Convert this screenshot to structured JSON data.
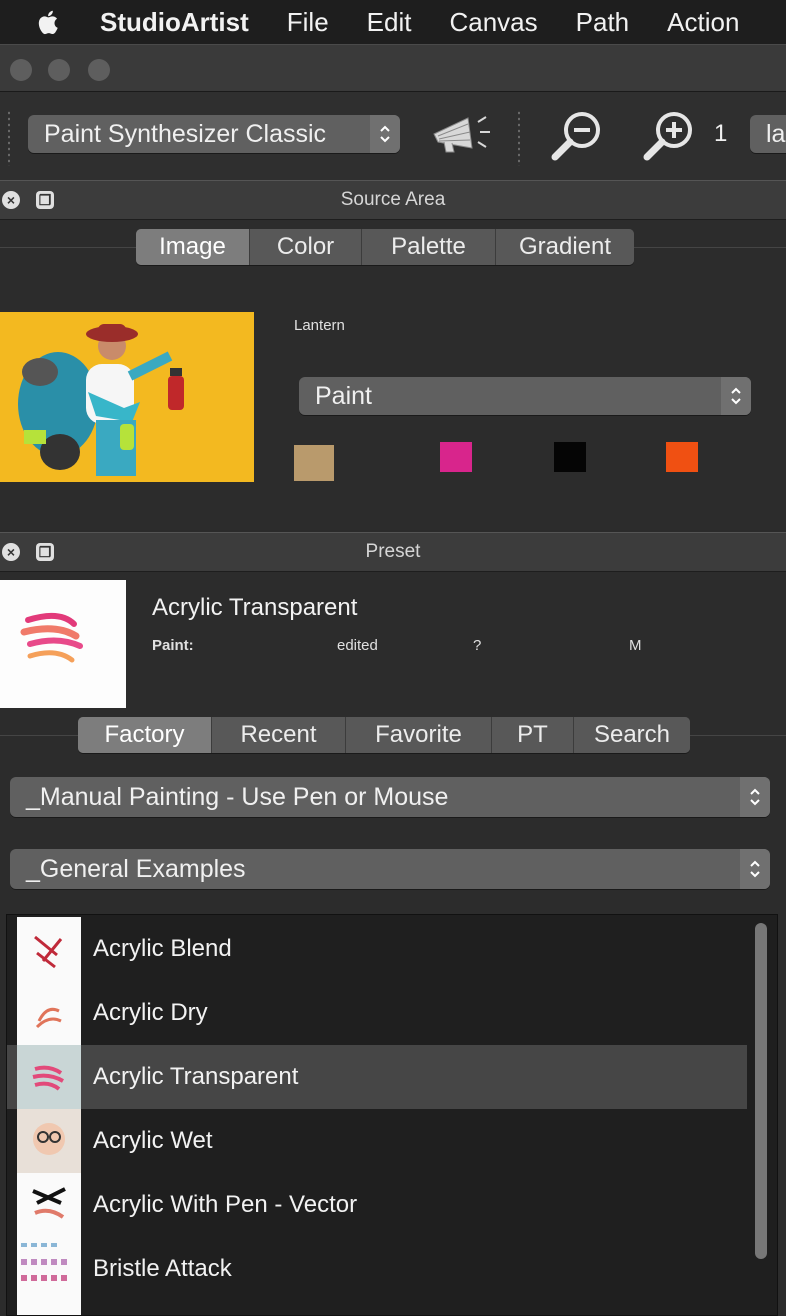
{
  "menubar": {
    "app_name": "StudioArtist",
    "items": [
      "File",
      "Edit",
      "Canvas",
      "Path",
      "Action"
    ]
  },
  "toolbar": {
    "mode_select": "Paint Synthesizer Classic",
    "zoom_value": "1",
    "layer_select": "la"
  },
  "source_area": {
    "title": "Source Area",
    "tabs": [
      "Image",
      "Color",
      "Palette",
      "Gradient"
    ],
    "active_tab": "Image",
    "image_name": "Lantern",
    "paint_select": "Paint",
    "swatches": [
      "#b99a6c",
      "#d8258c",
      "#050505",
      "#f05012"
    ]
  },
  "preset": {
    "title": "Preset",
    "name": "Acrylic Transparent",
    "info_label": "Paint:",
    "info_edited": "edited",
    "info_q": "?",
    "info_m": "M",
    "tabs": [
      "Factory",
      "Recent",
      "Favorite",
      "PT",
      "Search"
    ],
    "active_tab": "Factory",
    "category_select": "_Manual Painting - Use Pen or Mouse",
    "group_select": "_General Examples",
    "list": [
      {
        "label": "Acrylic Blend",
        "selected": false
      },
      {
        "label": "Acrylic Dry",
        "selected": false
      },
      {
        "label": "Acrylic Transparent",
        "selected": true
      },
      {
        "label": "Acrylic Wet",
        "selected": false
      },
      {
        "label": "Acrylic With Pen - Vector",
        "selected": false
      },
      {
        "label": "Bristle Attack",
        "selected": false
      }
    ]
  }
}
